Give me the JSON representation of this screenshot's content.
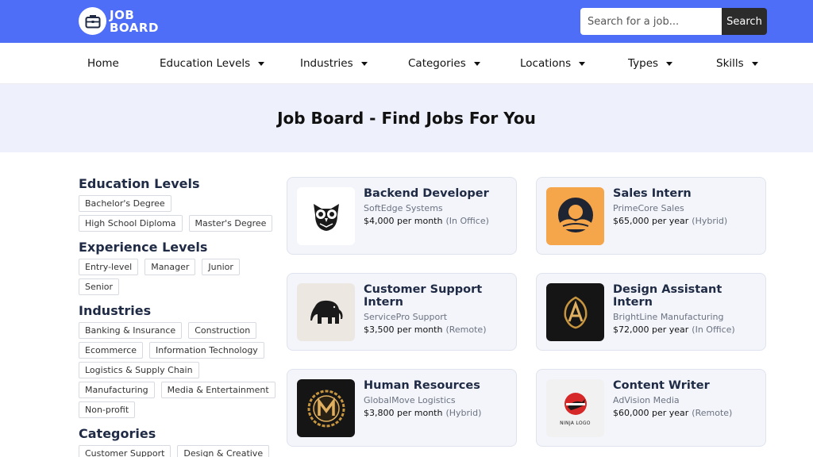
{
  "brand": {
    "line1": "JOB",
    "line2": "BOARD"
  },
  "search": {
    "placeholder": "Search for a job...",
    "button": "Search"
  },
  "nav": {
    "home": "Home",
    "education": "Education Levels",
    "industries": "Industries",
    "categories": "Categories",
    "locations": "Locations",
    "types": "Types",
    "skills": "Skills"
  },
  "hero": {
    "title": "Job Board - Find Jobs For You"
  },
  "sidebar": {
    "education": {
      "title": "Education Levels",
      "tags": [
        "Bachelor's Degree",
        "High School Diploma",
        "Master's Degree"
      ]
    },
    "experience": {
      "title": "Experience Levels",
      "tags": [
        "Entry-level",
        "Manager",
        "Junior",
        "Senior"
      ]
    },
    "industries": {
      "title": "Industries",
      "tags": [
        "Banking & Insurance",
        "Construction",
        "Ecommerce",
        "Information Technology",
        "Logistics & Supply Chain",
        "Manufacturing",
        "Media & Entertainment",
        "Non-profit"
      ]
    },
    "categories": {
      "title": "Categories",
      "tags": [
        "Customer Support",
        "Design & Creative"
      ]
    }
  },
  "jobs": [
    {
      "title": "Backend Developer",
      "company": "SoftEdge Systems",
      "pay": "$4,000 per month",
      "mode": "(In Office)",
      "icon": "owl-logo"
    },
    {
      "title": "Sales Intern",
      "company": "PrimeCore Sales",
      "pay": "$65,000 per year",
      "mode": "(Hybrid)",
      "icon": "sunset-logo"
    },
    {
      "title": "Customer Support Intern",
      "company": "ServicePro Support",
      "pay": "$3,500 per month",
      "mode": "(Remote)",
      "icon": "elephant-logo"
    },
    {
      "title": "Design Assistant Intern",
      "company": "BrightLine Manufacturing",
      "pay": "$72,000 per year",
      "mode": "(In Office)",
      "icon": "gold-a-logo"
    },
    {
      "title": "Human Resources",
      "company": "GlobalMove Logistics",
      "pay": "$3,800 per month",
      "mode": "(Hybrid)",
      "icon": "gold-m-logo"
    },
    {
      "title": "Content Writer",
      "company": "AdVision Media",
      "pay": "$60,000 per year",
      "mode": "(Remote)",
      "icon": "ninja-logo",
      "logo_text": "NINJA LOGO"
    }
  ],
  "colors": {
    "header": "#4f6ef7",
    "hero_bg": "#eef1fb",
    "card_bg": "#f3f5fb",
    "search_button": "#2b2b2b"
  }
}
